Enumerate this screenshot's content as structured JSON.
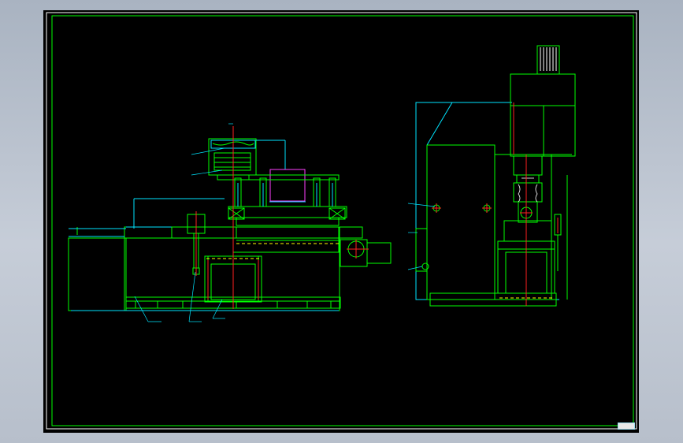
{
  "colors": {
    "background": "#b8c0cc",
    "sheet": "#000000",
    "primary_line": "#00ff00",
    "secondary_line": "#00e5ff",
    "center_line": "#ff2020",
    "hidden_line": "#ffff00",
    "part_highlight": "#ff40ff",
    "frame_white": "#ffffff"
  },
  "title_block": {
    "text": ""
  }
}
